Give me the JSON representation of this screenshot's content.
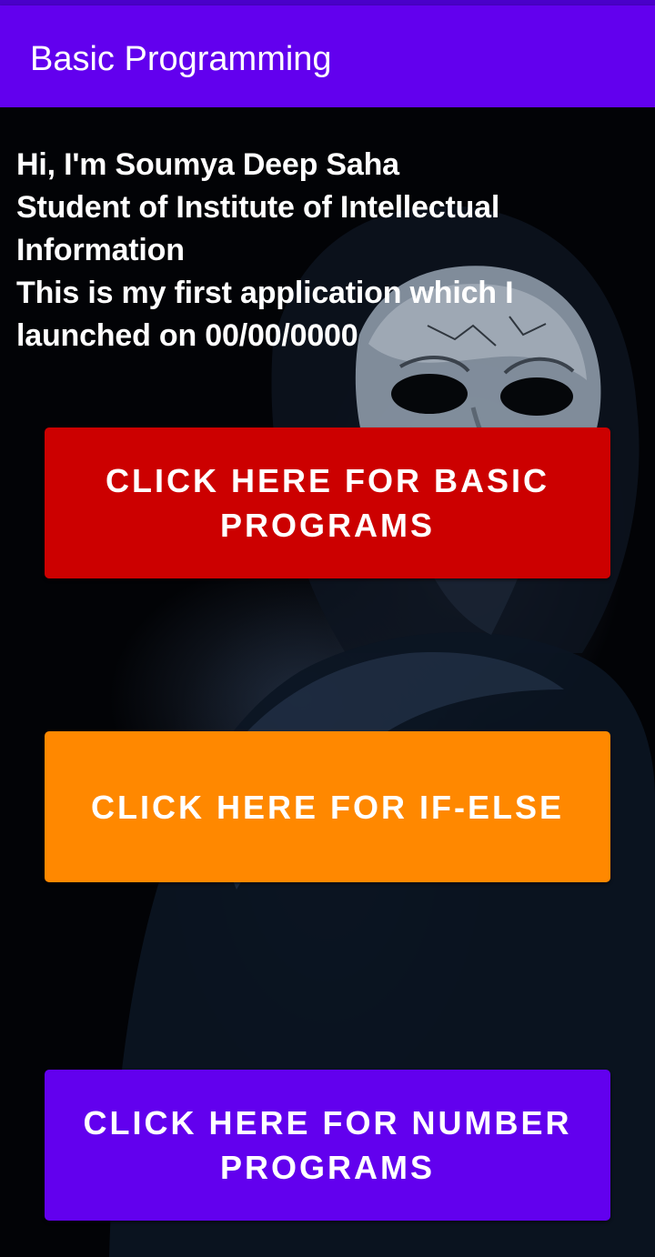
{
  "app_bar": {
    "title": "Basic Programming",
    "color": "#6200ee"
  },
  "intro": {
    "lines": [
      "Hi, I'm Soumya Deep Saha",
      "Student of Institute of Intellectual",
      "Information",
      "This is my first application which I",
      "launched on 00/00/0000"
    ]
  },
  "buttons": {
    "basic": {
      "label": "CLICK HERE FOR BASIC PROGRAMS",
      "color": "#cc0000"
    },
    "ifelse": {
      "label": "CLICK HERE FOR IF-ELSE",
      "color": "#ff8800"
    },
    "number": {
      "label": "CLICK HERE FOR NUMBER PROGRAMS",
      "color": "#6200ee"
    }
  },
  "background": {
    "icon": "hooded-masked-figure-image"
  }
}
